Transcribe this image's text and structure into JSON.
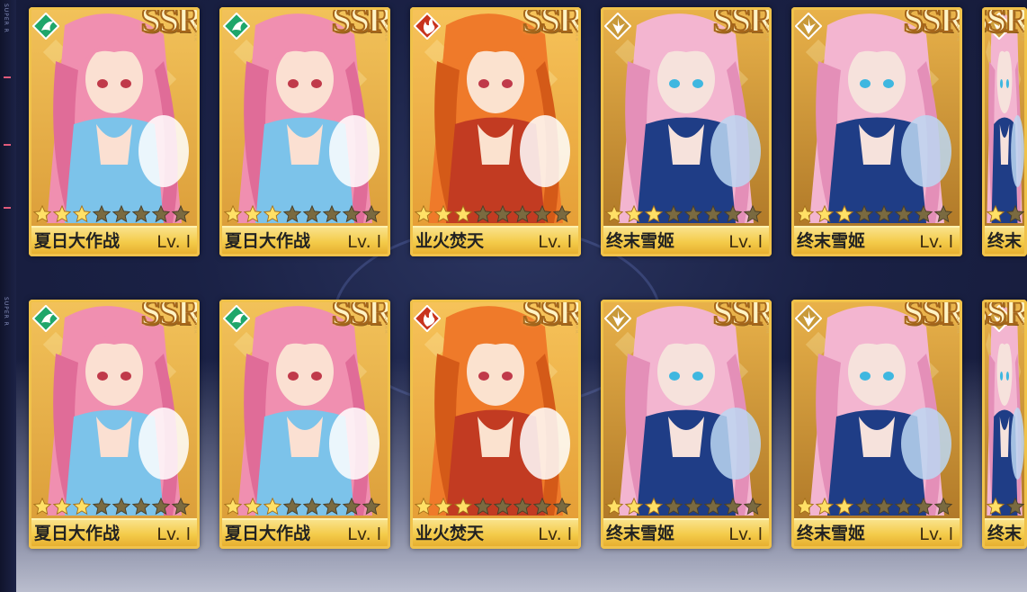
{
  "ssr_label": "SSR",
  "ssr_sub": "SUPER R",
  "side_text": "SUPER R",
  "cards": [
    {
      "name": "夏日大作战",
      "level": "Lv. l",
      "element": "wind",
      "element_color": "#1fa66a",
      "stars": 3,
      "max_stars": 8,
      "art": "pink"
    },
    {
      "name": "夏日大作战",
      "level": "Lv. l",
      "element": "wind",
      "element_color": "#1fa66a",
      "stars": 3,
      "max_stars": 8,
      "art": "pink"
    },
    {
      "name": "业火焚天",
      "level": "Lv. l",
      "element": "fire",
      "element_color": "#c8341e",
      "stars": 3,
      "max_stars": 8,
      "art": "orange"
    },
    {
      "name": "终末雪姬",
      "level": "Lv. l",
      "element": "light",
      "element_color": "#c99a3a",
      "stars": 3,
      "max_stars": 8,
      "art": "blue"
    },
    {
      "name": "终末雪姬",
      "level": "Lv. l",
      "element": "light",
      "element_color": "#c99a3a",
      "stars": 3,
      "max_stars": 8,
      "art": "blue"
    },
    {
      "name": "终末",
      "level": "",
      "element": "light",
      "element_color": "#c99a3a",
      "stars": 1,
      "max_stars": 8,
      "art": "blue"
    },
    {
      "name": "夏日大作战",
      "level": "Lv. l",
      "element": "wind",
      "element_color": "#1fa66a",
      "stars": 3,
      "max_stars": 8,
      "art": "pink"
    },
    {
      "name": "夏日大作战",
      "level": "Lv. l",
      "element": "wind",
      "element_color": "#1fa66a",
      "stars": 3,
      "max_stars": 8,
      "art": "pink"
    },
    {
      "name": "业火焚天",
      "level": "Lv. l",
      "element": "fire",
      "element_color": "#c8341e",
      "stars": 3,
      "max_stars": 8,
      "art": "orange"
    },
    {
      "name": "终末雪姬",
      "level": "Lv. l",
      "element": "light",
      "element_color": "#c99a3a",
      "stars": 3,
      "max_stars": 8,
      "art": "blue"
    },
    {
      "name": "终末雪姬",
      "level": "Lv. l",
      "element": "light",
      "element_color": "#c99a3a",
      "stars": 3,
      "max_stars": 8,
      "art": "blue"
    },
    {
      "name": "终末",
      "level": "",
      "element": "light",
      "element_color": "#c99a3a",
      "stars": 1,
      "max_stars": 8,
      "art": "blue"
    }
  ]
}
